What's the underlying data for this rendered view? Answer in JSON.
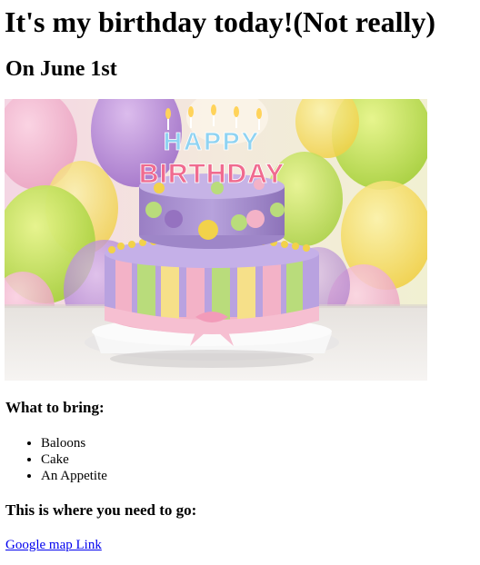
{
  "page": {
    "title": "It's my birthday today!(Not really)",
    "date_heading": "On June 1st"
  },
  "image": {
    "alt": "Colorful birthday cake with HAPPY BIRTHDAY candles and balloons",
    "candle_text_line1": "HAPPY",
    "candle_text_line2": "BIRTHDAY"
  },
  "bring": {
    "heading": "What to bring:",
    "items": [
      "Baloons",
      "Cake",
      "An Appetite"
    ]
  },
  "directions": {
    "heading": "This is where you need to go:",
    "link_label": "Google map Link"
  },
  "colors": {
    "link": "#0000ee",
    "text": "#000000"
  }
}
